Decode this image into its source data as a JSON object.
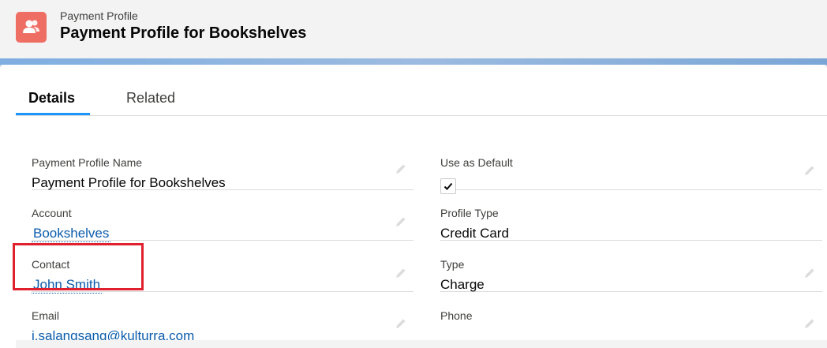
{
  "header": {
    "object_label": "Payment Profile",
    "record_title": "Payment Profile for Bookshelves",
    "icon": "contacts-icon"
  },
  "tabs": [
    {
      "label": "Details",
      "active": true
    },
    {
      "label": "Related",
      "active": false
    }
  ],
  "fields": {
    "payment_profile_name": {
      "label": "Payment Profile Name",
      "value": "Payment Profile for Bookshelves"
    },
    "account": {
      "label": "Account",
      "value": "Bookshelves"
    },
    "contact": {
      "label": "Contact",
      "value": "John Smith"
    },
    "email": {
      "label": "Email",
      "value": "j.salangsang@kulturra.com"
    },
    "use_as_default": {
      "label": "Use as Default",
      "checked": true
    },
    "profile_type": {
      "label": "Profile Type",
      "value": "Credit Card"
    },
    "type": {
      "label": "Type",
      "value": "Charge"
    },
    "phone": {
      "label": "Phone",
      "value": ""
    }
  },
  "colors": {
    "brand_icon": "#ef6e64",
    "link": "#0b5cab",
    "tab_underline": "#1b96ff",
    "highlight_box": "#e0202d"
  }
}
